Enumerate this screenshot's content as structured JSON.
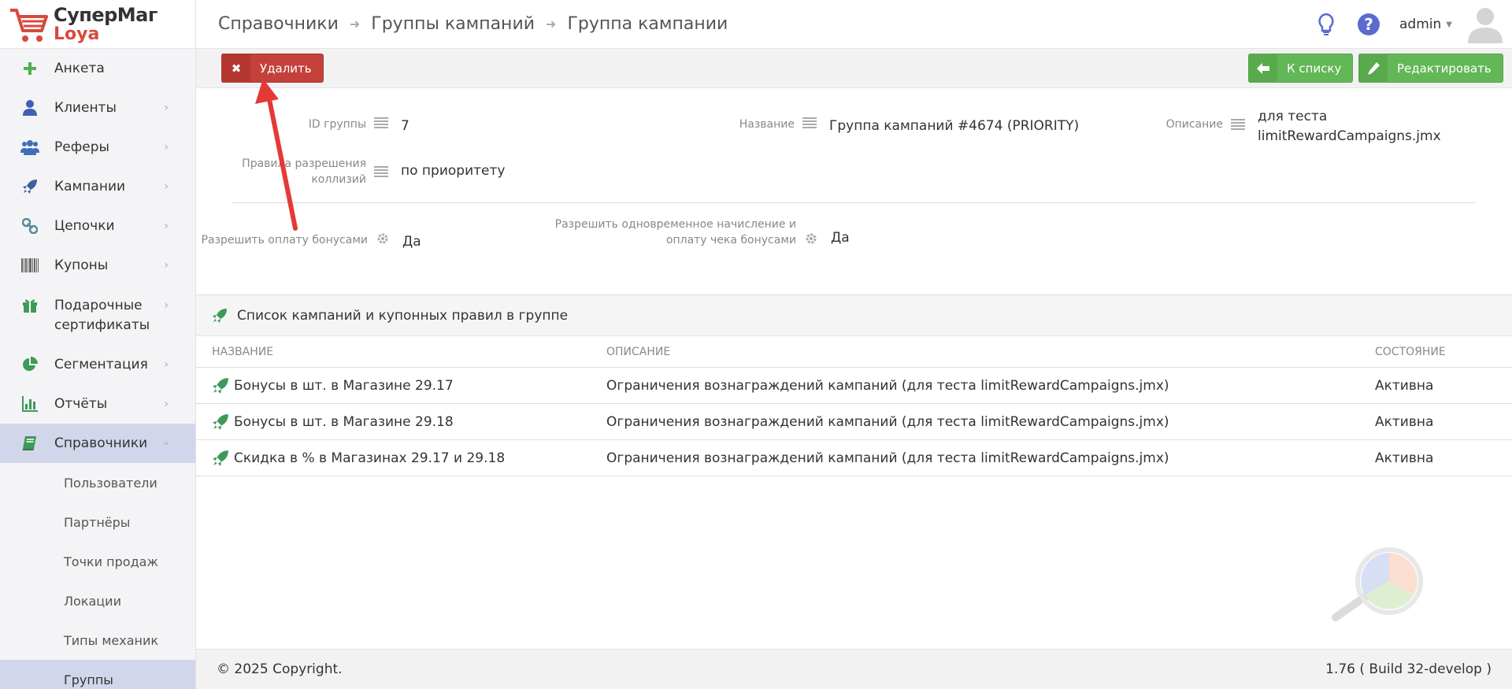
{
  "logo": {
    "title": "СуперМаг",
    "subtitle": "Loya"
  },
  "sidebar": {
    "items": [
      {
        "label": "Анкета",
        "icon": "plus-icon"
      },
      {
        "label": "Клиенты",
        "icon": "user-icon"
      },
      {
        "label": "Реферы",
        "icon": "users-icon"
      },
      {
        "label": "Кампании",
        "icon": "rocket-icon"
      },
      {
        "label": "Цепочки",
        "icon": "link-icon"
      },
      {
        "label": "Купоны",
        "icon": "barcode-icon"
      },
      {
        "label": "Подарочные сертификаты",
        "icon": "gift-icon"
      },
      {
        "label": "Сегментация",
        "icon": "pie-chart-icon"
      },
      {
        "label": "Отчёты",
        "icon": "bar-chart-icon"
      },
      {
        "label": "Справочники",
        "icon": "book-icon"
      }
    ],
    "subitems": [
      "Пользователи",
      "Партнёры",
      "Точки продаж",
      "Локации",
      "Типы механик",
      "Группы"
    ]
  },
  "header": {
    "breadcrumbs": [
      "Справочники",
      "Группы кампаний",
      "Группа кампании"
    ],
    "user": "admin"
  },
  "toolbar": {
    "delete_label": "Удалить",
    "list_label": "К списку",
    "edit_label": "Редактировать"
  },
  "details": {
    "id_label": "ID группы",
    "id_value": "7",
    "name_label": "Название",
    "name_value": "Группа кампаний #4674 (PRIORITY)",
    "desc_label": "Описание",
    "desc_value": "для теста limitRewardCampaigns.jmx",
    "collision_label": "Правила разрешения коллизий",
    "collision_value": "по приоритету",
    "bonus_pay_label": "Разрешить оплату бонусами",
    "bonus_pay_value": "Да",
    "simultaneous_label": "Разрешить одновременное начисление и оплату чека бонусами",
    "simultaneous_value": "Да"
  },
  "campaigns": {
    "title": "Список кампаний и купонных правил в группе",
    "columns": [
      "НАЗВАНИЕ",
      "ОПИСАНИЕ",
      "СОСТОЯНИЕ"
    ],
    "rows": [
      {
        "name": "Бонусы в шт. в Магазине 29.17",
        "description": "Ограничения вознаграждений кампаний (для теста limitRewardCampaigns.jmx)",
        "status": "Активна"
      },
      {
        "name": "Бонусы в шт. в Магазине 29.18",
        "description": "Ограничения вознаграждений кампаний (для теста limitRewardCampaigns.jmx)",
        "status": "Активна"
      },
      {
        "name": "Скидка в % в Магазинах 29.17 и 29.18",
        "description": "Ограничения вознаграждений кампаний (для теста limitRewardCampaigns.jmx)",
        "status": "Активна"
      }
    ]
  },
  "footer": {
    "copyright": "© 2025 Copyright.",
    "version": "1.76 ( Build 32-develop )"
  },
  "colors": {
    "delete": "#c4413b",
    "success": "#62b756",
    "accent": "#5b6bd1",
    "active_nav": "#d2d6ea"
  }
}
